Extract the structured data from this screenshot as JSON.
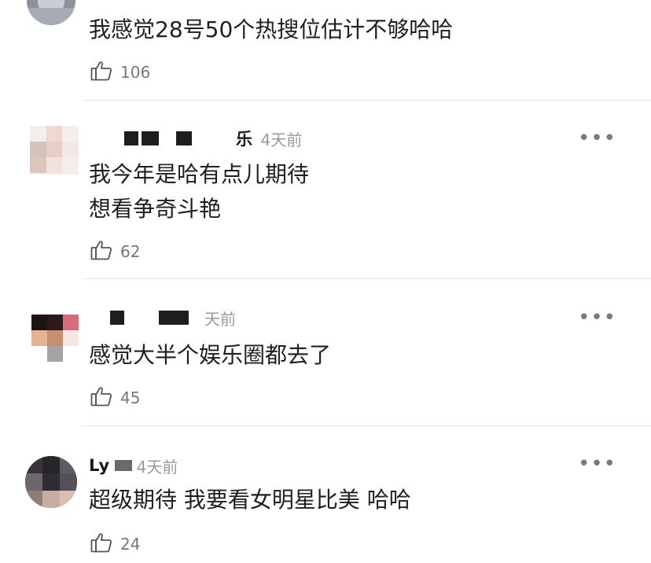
{
  "comments": [
    {
      "username": "",
      "timestamp": "",
      "lines": [
        "我感觉28号50个热搜位估计不够哈哈"
      ],
      "likes": "106"
    },
    {
      "username": "乐",
      "timestamp": "4天前",
      "lines": [
        "我今年是哈有点儿期待",
        "想看争奇斗艳"
      ],
      "likes": "62"
    },
    {
      "username": "",
      "timestamp": "天前",
      "lines": [
        "感觉大半个娱乐圈都去了"
      ],
      "likes": "45"
    },
    {
      "username": "Ly",
      "timestamp": "4天前",
      "lines": [
        "超级期待 我要看女明星比美 哈哈"
      ],
      "likes": "24"
    }
  ],
  "icons": {
    "like": "thumbs-up-icon",
    "more": "more-dots-icon"
  },
  "more_label": "•••",
  "colors": {
    "text": "#1f1f1f",
    "meta": "#9a9a9a",
    "divider": "#e4e4e4",
    "count": "#777777"
  }
}
